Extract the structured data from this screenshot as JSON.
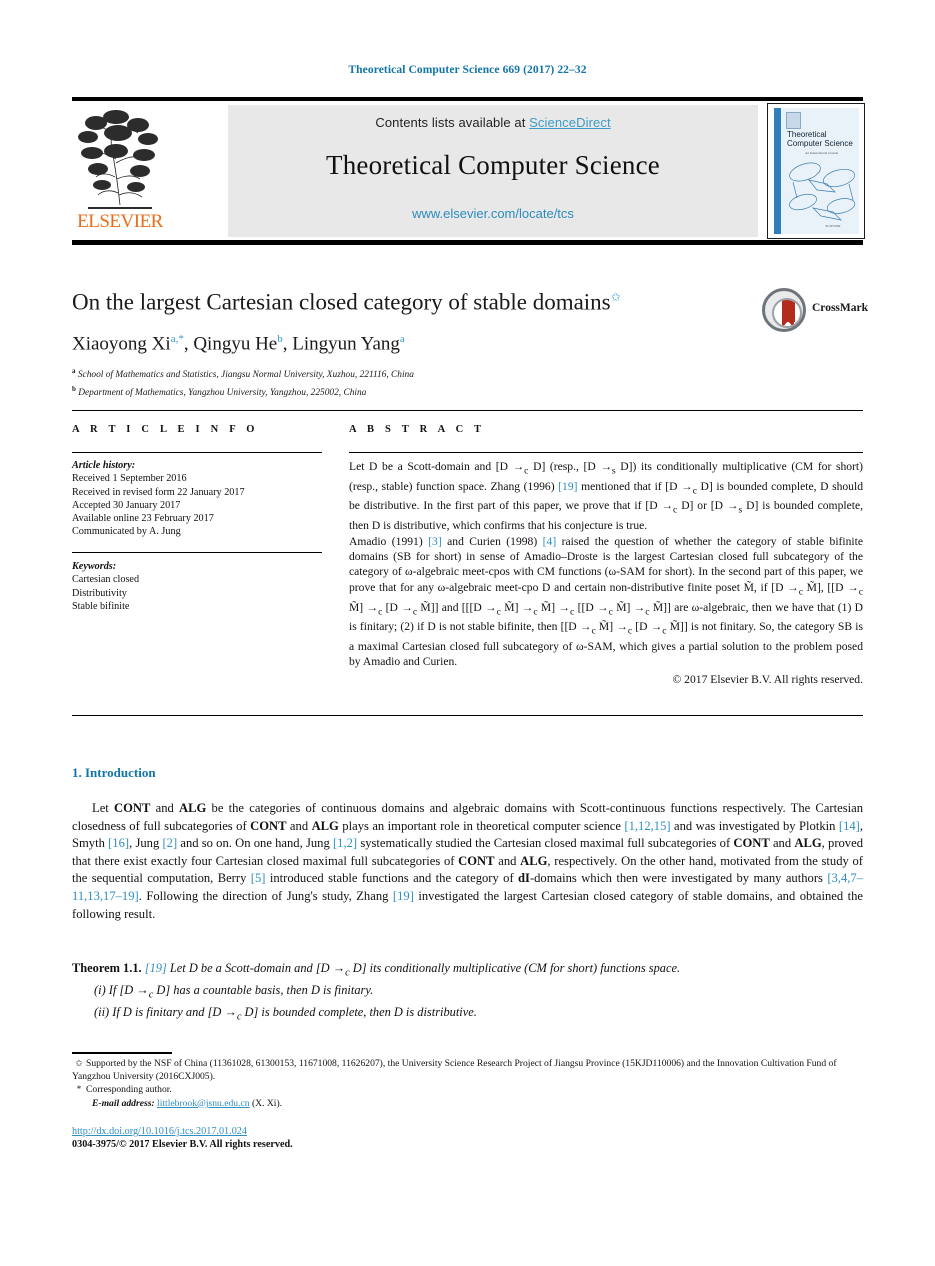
{
  "running_head": "Theoretical Computer Science 669 (2017) 22–32",
  "masthead": {
    "contents_prefix": "Contents lists available at ",
    "sciencedirect": "ScienceDirect",
    "journal_name": "Theoretical Computer Science",
    "journal_url": "www.elsevier.com/locate/tcs",
    "publisher_wordmark": "ELSEVIER",
    "cover": {
      "title_line1": "Theoretical",
      "title_line2": "Computer Science",
      "subtitle": "An International Journal",
      "footer": "ELSEVIER"
    }
  },
  "article": {
    "title": "On the largest Cartesian closed category of stable domains",
    "title_footnote_mark": "✩",
    "authors_html": "Xiaoyong Xi<sup>a,*</sup>, Qingyu He<sup>b</sup>, Lingyun Yang<sup>a</sup>",
    "affiliations": [
      {
        "mark": "a",
        "text": "School of Mathematics and Statistics, Jiangsu Normal University, Xuzhou, 221116, China"
      },
      {
        "mark": "b",
        "text": "Department of Mathematics, Yangzhou University, Yangzhou, 225002, China"
      }
    ],
    "crossmark_label": "CrossMark"
  },
  "info": {
    "header": "A R T I C L E   I N F O",
    "history_label": "Article history:",
    "history": [
      "Received 1 September 2016",
      "Received in revised form 22 January 2017",
      "Accepted 30 January 2017",
      "Available online 23 February 2017",
      "Communicated by A. Jung"
    ],
    "keywords_label": "Keywords:",
    "keywords": [
      "Cartesian closed",
      "Distributivity",
      "Stable bifinite"
    ]
  },
  "abstract": {
    "header": "A B S T R A C T",
    "paragraph1": "Let D be a Scott-domain and [D →<sub>c</sub> D] (resp., [D →<sub>s</sub> D]) its conditionally multiplicative (CM for short) (resp., stable) function space. Zhang (1996) <span class=\"ref\">[19]</span> mentioned that if [D →<sub>c</sub> D] is bounded complete, D should be distributive. In the first part of this paper, we prove that if [D →<sub>c</sub> D] or [D →<sub>s</sub> D] is bounded complete, then D is distributive, which confirms that his conjecture is true.",
    "paragraph2": "Amadio (1991) <span class=\"ref\">[3]</span> and Curien (1998) <span class=\"ref\">[4]</span> raised the question of whether the category of stable bifinite domains (SB for short) in sense of Amadio–Droste is the largest Cartesian closed full subcategory of the category of ω-algebraic meet-cpos with CM functions (ω-SAM for short). In the second part of this paper, we prove that for any ω-algebraic meet-cpo D and certain non-distributive finite poset M̃, if [D →<sub>c</sub> M̃], [[D →<sub>c</sub> M̃] →<sub>c</sub> [D →<sub>c</sub> M̃]] and [[[D →<sub>c</sub> M̃] →<sub>c</sub> M̃] →<sub>c</sub> [[D →<sub>c</sub> M̃] →<sub>c</sub> M̃]] are ω-algebraic, then we have that (1) D is finitary; (2) if D is not stable bifinite, then [[D →<sub>c</sub> M̃] →<sub>c</sub> [D →<sub>c</sub> M̃]] is not finitary. So, the category SB is a maximal Cartesian closed full subcategory of ω-SAM, which gives a partial solution to the problem posed by Amadio and Curien.",
    "copyright": "© 2017 Elsevier B.V. All rights reserved."
  },
  "body": {
    "section_number": "1.",
    "section_title": "Introduction",
    "paragraph": "Let <b>CONT</b> and <b>ALG</b> be the categories of continuous domains and algebraic domains with Scott-continuous functions respectively. The Cartesian closedness of full subcategories of <b>CONT</b> and <b>ALG</b> plays an important role in theoretical computer science <span class=\"ref\">[1,12,15]</span> and was investigated by Plotkin <span class=\"ref\">[14]</span>, Smyth <span class=\"ref\">[16]</span>, Jung <span class=\"ref\">[2]</span> and so on. On one hand, Jung <span class=\"ref\">[1,2]</span> systematically studied the Cartesian closed maximal full subcategories of <b>CONT</b> and <b>ALG</b>, proved that there exist exactly four Cartesian closed maximal full subcategories of <b>CONT</b> and <b>ALG</b>, respectively. On the other hand, motivated from the study of the sequential computation, Berry <span class=\"ref\">[5]</span> introduced stable functions and the category of <b>dI</b>-domains which then were investigated by many authors <span class=\"ref\">[3,4,7–11,13,17–19]</span>. Following the direction of Jung's study, Zhang <span class=\"ref\">[19]</span> investigated the largest Cartesian closed category of stable domains, and obtained the following result."
  },
  "theorem": {
    "label": "Theorem 1.1.",
    "ref": "[19]",
    "statement": "Let D be a Scott-domain and [D →<sub>c</sub> D] its conditionally multiplicative (CM for short) functions space.",
    "items": [
      "(i) If [D →<sub>c</sub> D] has a countable basis, then D is finitary.",
      "(ii) If D is finitary and [D →<sub>c</sub> D] is bounded complete, then D is distributive."
    ]
  },
  "footnotes": {
    "star_mark": "✩",
    "star_text": "Supported by the NSF of China (11361028, 61300153, 11671008, 11626207), the University Science Research Project of Jiangsu Province (15KJD110006) and the Innovation Cultivation Fund of Yangzhou University (2016CXJ005).",
    "corr_mark": "*",
    "corr_text": "Corresponding author.",
    "email_label": "E-mail address:",
    "email": "littlebrook@jsnu.edu.cn",
    "email_suffix": "(X. Xi)."
  },
  "footer": {
    "doi": "http://dx.doi.org/10.1016/j.tcs.2017.01.024",
    "issn_line": "0304-3975/© 2017 Elsevier B.V. All rights reserved."
  },
  "colors": {
    "link": "#2f8fc0",
    "heading_blue": "#1175a8",
    "band_gray": "#e8e8e8",
    "elsevier_orange": "#e86c1a",
    "crossmark_red": "#b32b1b"
  }
}
